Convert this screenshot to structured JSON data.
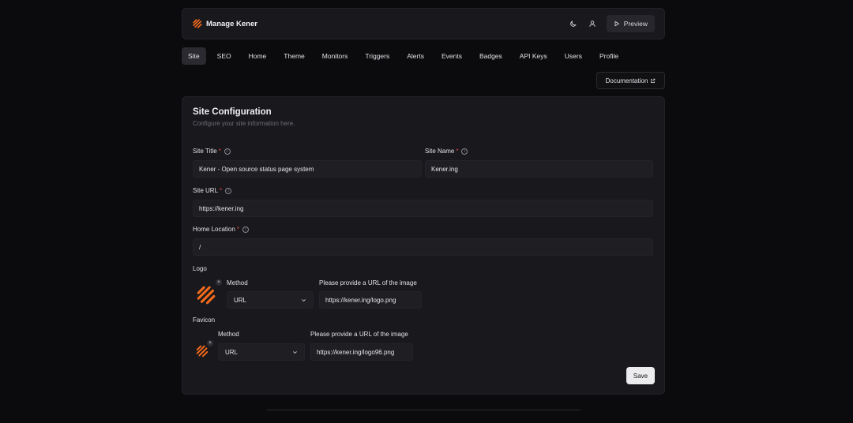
{
  "header": {
    "title": "Manage Kener",
    "preview_label": "Preview",
    "icons": [
      "theme-moon-icon",
      "user-icon",
      "play-icon"
    ]
  },
  "tabs": [
    {
      "label": "Site",
      "active": true
    },
    {
      "label": "SEO"
    },
    {
      "label": "Home"
    },
    {
      "label": "Theme"
    },
    {
      "label": "Monitors"
    },
    {
      "label": "Triggers"
    },
    {
      "label": "Alerts"
    },
    {
      "label": "Events"
    },
    {
      "label": "Badges"
    },
    {
      "label": "API Keys"
    },
    {
      "label": "Users"
    },
    {
      "label": "Profile"
    }
  ],
  "documentation_label": "Documentation",
  "card": {
    "title": "Site Configuration",
    "subtitle": "Configure your site information here.",
    "site_title": {
      "label": "Site Title",
      "required": "*",
      "value": "Kener - Open source status page system"
    },
    "site_name": {
      "label": "Site Name",
      "required": "*",
      "value": "Kener.ing"
    },
    "site_url": {
      "label": "Site URL",
      "required": "*",
      "value": "https://kener.ing"
    },
    "home_location": {
      "label": "Home Location",
      "required": "*",
      "value": "/"
    },
    "logo": {
      "label": "Logo",
      "method_label": "Method",
      "method_value": "URL",
      "url_label": "Please provide a URL of the image",
      "url_value": "https://kener.ing/logo.png"
    },
    "favicon": {
      "label": "Favicon",
      "method_label": "Method",
      "method_value": "URL",
      "url_label": "Please provide a URL of the image",
      "url_value": "https://kener.ing/logo96.png"
    },
    "save_label": "Save"
  },
  "colors": {
    "accent": "#f26a1b",
    "background": "#0b0b0e",
    "card": "#18181d",
    "required": "#e5484d"
  }
}
